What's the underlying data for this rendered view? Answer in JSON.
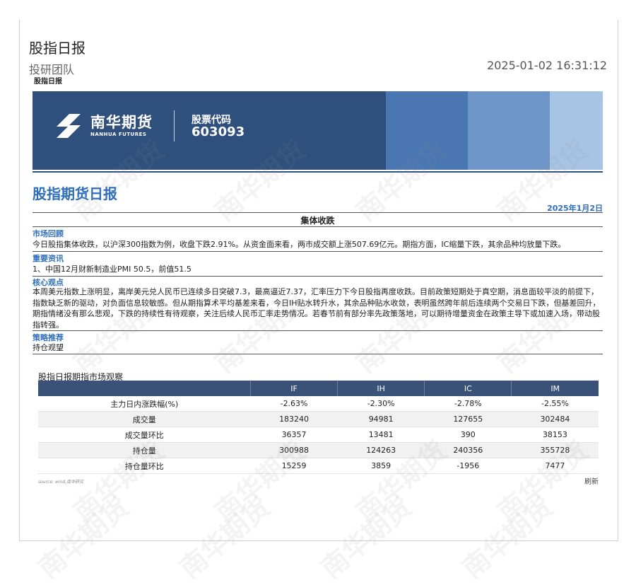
{
  "header": {
    "title": "股指日报",
    "team": "投研团队",
    "timestamp": "2025-01-02 16:31:12",
    "subtitle": "股指日报"
  },
  "banner": {
    "logo_cn": "南华期货",
    "logo_en": "NANHUA FUTURES",
    "code_label": "股票代码",
    "code_value": "603093",
    "colors": {
      "base": "#2f4f7d",
      "block1": "#4a76b1",
      "block2": "#6d95c7",
      "block3": "#a8c4e4"
    }
  },
  "report": {
    "title": "股指期货日报",
    "date": "2025年1月2日",
    "headline": "集体收跌",
    "accent": "#2f6fba"
  },
  "sections": [
    {
      "heading": "市场回顾",
      "text": "今日股指集体收跌，以沪深300指数为例，收盘下跌2.91%。从资金面来看，两市成交额上涨507.69亿元。期指方面，IC缩量下跌，其余品种均放量下跌。"
    },
    {
      "heading": "重要资讯",
      "text": "1、中国12月财新制造业PMI 50.5，前值51.5"
    },
    {
      "heading": "核心观点",
      "text": "本周美元指数上涨明显，离岸美元兑人民币已连续多日突破7.3，最高逼近7.37，汇率压力下今日股指再度收跌。目前政策短期处于真空期，消息面较平淡的前提下，指数缺乏新的驱动，对负面信息较敏感。但从期指算术平均基差来看，今日IH贴水转升水，其余品种贴水收敛，表明虽然跨年前后连续两个交易日下跌，但基差回升，期指情绪没有那么悲观，下跌的持续性有待观察，关注后续人民币汇率走势情况。若春节前有部分率先政策落地，可以期待增量资金在政策主导下或加速入场，带动股指转强。"
    },
    {
      "heading": "策略推荐",
      "text": "持仓观望"
    }
  ],
  "table": {
    "title": "股指日报期指市场观察",
    "columns": [
      "",
      "IF",
      "IH",
      "IC",
      "IM"
    ],
    "rows": [
      [
        "主力日内涨跌幅(%)",
        "-2.63%",
        "-2.30%",
        "-2.78%",
        "-2.55%"
      ],
      [
        "成交量",
        "183240",
        "94981",
        "127655",
        "302484"
      ],
      [
        "成交量环比",
        "36357",
        "13481",
        "390",
        "38153"
      ],
      [
        "持仓量",
        "300988",
        "124263",
        "240356",
        "355728"
      ],
      [
        "持仓量环比",
        "15259",
        "3859",
        "-1956",
        "7477"
      ]
    ],
    "source": "source: wind,南华研究",
    "refresh_label": "刷新"
  },
  "watermark": "南华期货"
}
